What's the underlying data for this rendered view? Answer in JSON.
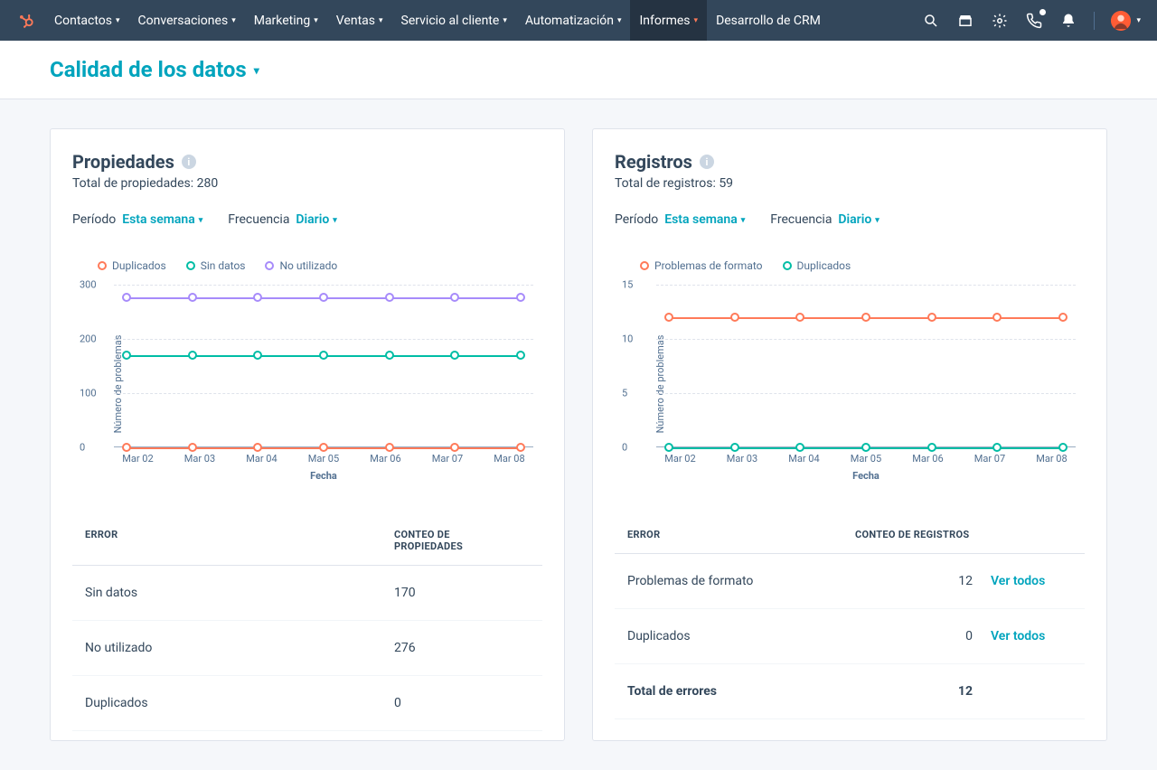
{
  "colors": {
    "orange": "#ff7a59",
    "teal": "#00bda5",
    "purple": "#a78bfa"
  },
  "nav": {
    "items": [
      {
        "label": "Contactos"
      },
      {
        "label": "Conversaciones"
      },
      {
        "label": "Marketing"
      },
      {
        "label": "Ventas"
      },
      {
        "label": "Servicio al cliente"
      },
      {
        "label": "Automatización"
      },
      {
        "label": "Informes",
        "active": true
      },
      {
        "label": "Desarrollo de CRM",
        "plain": true
      }
    ]
  },
  "page": {
    "title": "Calidad de los datos"
  },
  "filters": {
    "period_label": "Período",
    "period_value": "Esta semana",
    "freq_label": "Frecuencia",
    "freq_value": "Diario"
  },
  "properties_card": {
    "title": "Propiedades",
    "total_label": "Total de propiedades: 280",
    "table_headers": {
      "err": "ERROR",
      "count": "CONTEO DE PROPIEDADES"
    },
    "table": [
      {
        "err": "Sin datos",
        "count": "170"
      },
      {
        "err": "No utilizado",
        "count": "276"
      },
      {
        "err": "Duplicados",
        "count": "0"
      }
    ]
  },
  "records_card": {
    "title": "Registros",
    "total_label": "Total de registros: 59",
    "table_headers": {
      "err": "ERROR",
      "count": "CONTEO DE REGISTROS"
    },
    "table": [
      {
        "err": "Problemas de formato",
        "count": "12",
        "link": "Ver todos"
      },
      {
        "err": "Duplicados",
        "count": "0",
        "link": "Ver todos"
      }
    ],
    "total_row": {
      "err": "Total de errores",
      "count": "12"
    }
  },
  "chart_data": [
    {
      "id": "properties",
      "type": "line",
      "xlabel": "Fecha",
      "ylabel": "Número de problemas",
      "ylim": [
        0,
        300
      ],
      "yticks": [
        0,
        100,
        200,
        300
      ],
      "categories": [
        "Mar 02",
        "Mar 03",
        "Mar 04",
        "Mar 05",
        "Mar 06",
        "Mar 07",
        "Mar 08"
      ],
      "series": [
        {
          "name": "Duplicados",
          "color": "#ff7a59",
          "values": [
            0,
            0,
            0,
            0,
            0,
            0,
            0
          ]
        },
        {
          "name": "Sin datos",
          "color": "#00bda5",
          "values": [
            170,
            170,
            170,
            170,
            170,
            170,
            170
          ]
        },
        {
          "name": "No utilizado",
          "color": "#a78bfa",
          "values": [
            276,
            276,
            276,
            276,
            276,
            276,
            276
          ]
        }
      ]
    },
    {
      "id": "records",
      "type": "line",
      "xlabel": "Fecha",
      "ylabel": "Número de problemas",
      "ylim": [
        0,
        15
      ],
      "yticks": [
        0,
        5,
        10,
        15
      ],
      "categories": [
        "Mar 02",
        "Mar 03",
        "Mar 04",
        "Mar 05",
        "Mar 06",
        "Mar 07",
        "Mar 08"
      ],
      "series": [
        {
          "name": "Problemas de formato",
          "color": "#ff7a59",
          "values": [
            12,
            12,
            12,
            12,
            12,
            12,
            12
          ]
        },
        {
          "name": "Duplicados",
          "color": "#00bda5",
          "values": [
            0,
            0,
            0,
            0,
            0,
            0,
            0
          ]
        }
      ]
    }
  ]
}
